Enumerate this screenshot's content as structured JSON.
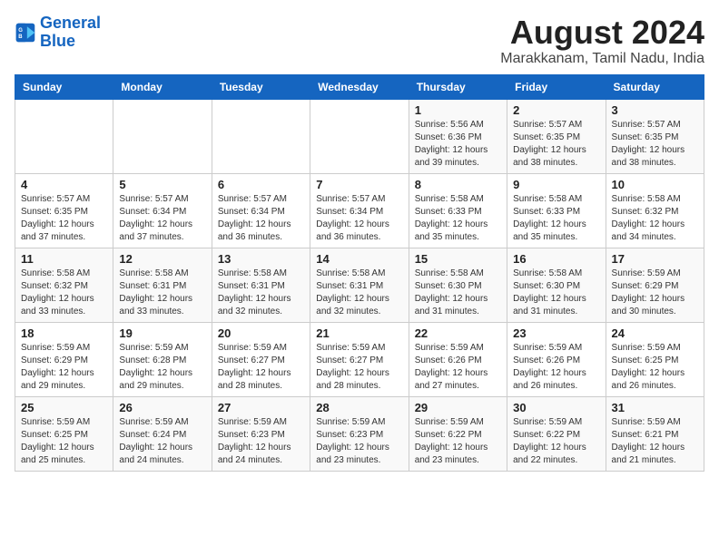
{
  "logo": {
    "line1": "General",
    "line2": "Blue"
  },
  "title": "August 2024",
  "subtitle": "Marakkanam, Tamil Nadu, India",
  "days_header": [
    "Sunday",
    "Monday",
    "Tuesday",
    "Wednesday",
    "Thursday",
    "Friday",
    "Saturday"
  ],
  "weeks": [
    [
      {
        "day": "",
        "detail": ""
      },
      {
        "day": "",
        "detail": ""
      },
      {
        "day": "",
        "detail": ""
      },
      {
        "day": "",
        "detail": ""
      },
      {
        "day": "1",
        "detail": "Sunrise: 5:56 AM\nSunset: 6:36 PM\nDaylight: 12 hours\nand 39 minutes."
      },
      {
        "day": "2",
        "detail": "Sunrise: 5:57 AM\nSunset: 6:35 PM\nDaylight: 12 hours\nand 38 minutes."
      },
      {
        "day": "3",
        "detail": "Sunrise: 5:57 AM\nSunset: 6:35 PM\nDaylight: 12 hours\nand 38 minutes."
      }
    ],
    [
      {
        "day": "4",
        "detail": "Sunrise: 5:57 AM\nSunset: 6:35 PM\nDaylight: 12 hours\nand 37 minutes."
      },
      {
        "day": "5",
        "detail": "Sunrise: 5:57 AM\nSunset: 6:34 PM\nDaylight: 12 hours\nand 37 minutes."
      },
      {
        "day": "6",
        "detail": "Sunrise: 5:57 AM\nSunset: 6:34 PM\nDaylight: 12 hours\nand 36 minutes."
      },
      {
        "day": "7",
        "detail": "Sunrise: 5:57 AM\nSunset: 6:34 PM\nDaylight: 12 hours\nand 36 minutes."
      },
      {
        "day": "8",
        "detail": "Sunrise: 5:58 AM\nSunset: 6:33 PM\nDaylight: 12 hours\nand 35 minutes."
      },
      {
        "day": "9",
        "detail": "Sunrise: 5:58 AM\nSunset: 6:33 PM\nDaylight: 12 hours\nand 35 minutes."
      },
      {
        "day": "10",
        "detail": "Sunrise: 5:58 AM\nSunset: 6:32 PM\nDaylight: 12 hours\nand 34 minutes."
      }
    ],
    [
      {
        "day": "11",
        "detail": "Sunrise: 5:58 AM\nSunset: 6:32 PM\nDaylight: 12 hours\nand 33 minutes."
      },
      {
        "day": "12",
        "detail": "Sunrise: 5:58 AM\nSunset: 6:31 PM\nDaylight: 12 hours\nand 33 minutes."
      },
      {
        "day": "13",
        "detail": "Sunrise: 5:58 AM\nSunset: 6:31 PM\nDaylight: 12 hours\nand 32 minutes."
      },
      {
        "day": "14",
        "detail": "Sunrise: 5:58 AM\nSunset: 6:31 PM\nDaylight: 12 hours\nand 32 minutes."
      },
      {
        "day": "15",
        "detail": "Sunrise: 5:58 AM\nSunset: 6:30 PM\nDaylight: 12 hours\nand 31 minutes."
      },
      {
        "day": "16",
        "detail": "Sunrise: 5:58 AM\nSunset: 6:30 PM\nDaylight: 12 hours\nand 31 minutes."
      },
      {
        "day": "17",
        "detail": "Sunrise: 5:59 AM\nSunset: 6:29 PM\nDaylight: 12 hours\nand 30 minutes."
      }
    ],
    [
      {
        "day": "18",
        "detail": "Sunrise: 5:59 AM\nSunset: 6:29 PM\nDaylight: 12 hours\nand 29 minutes."
      },
      {
        "day": "19",
        "detail": "Sunrise: 5:59 AM\nSunset: 6:28 PM\nDaylight: 12 hours\nand 29 minutes."
      },
      {
        "day": "20",
        "detail": "Sunrise: 5:59 AM\nSunset: 6:27 PM\nDaylight: 12 hours\nand 28 minutes."
      },
      {
        "day": "21",
        "detail": "Sunrise: 5:59 AM\nSunset: 6:27 PM\nDaylight: 12 hours\nand 28 minutes."
      },
      {
        "day": "22",
        "detail": "Sunrise: 5:59 AM\nSunset: 6:26 PM\nDaylight: 12 hours\nand 27 minutes."
      },
      {
        "day": "23",
        "detail": "Sunrise: 5:59 AM\nSunset: 6:26 PM\nDaylight: 12 hours\nand 26 minutes."
      },
      {
        "day": "24",
        "detail": "Sunrise: 5:59 AM\nSunset: 6:25 PM\nDaylight: 12 hours\nand 26 minutes."
      }
    ],
    [
      {
        "day": "25",
        "detail": "Sunrise: 5:59 AM\nSunset: 6:25 PM\nDaylight: 12 hours\nand 25 minutes."
      },
      {
        "day": "26",
        "detail": "Sunrise: 5:59 AM\nSunset: 6:24 PM\nDaylight: 12 hours\nand 24 minutes."
      },
      {
        "day": "27",
        "detail": "Sunrise: 5:59 AM\nSunset: 6:23 PM\nDaylight: 12 hours\nand 24 minutes."
      },
      {
        "day": "28",
        "detail": "Sunrise: 5:59 AM\nSunset: 6:23 PM\nDaylight: 12 hours\nand 23 minutes."
      },
      {
        "day": "29",
        "detail": "Sunrise: 5:59 AM\nSunset: 6:22 PM\nDaylight: 12 hours\nand 23 minutes."
      },
      {
        "day": "30",
        "detail": "Sunrise: 5:59 AM\nSunset: 6:22 PM\nDaylight: 12 hours\nand 22 minutes."
      },
      {
        "day": "31",
        "detail": "Sunrise: 5:59 AM\nSunset: 6:21 PM\nDaylight: 12 hours\nand 21 minutes."
      }
    ]
  ]
}
